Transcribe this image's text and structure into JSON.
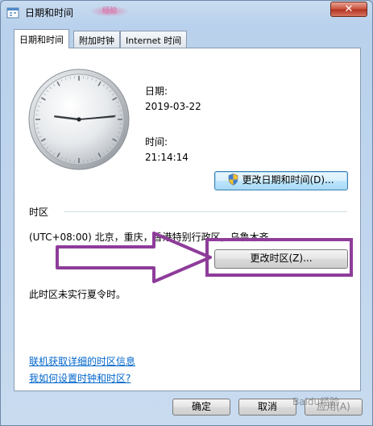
{
  "window": {
    "title": "日期和时间",
    "title_smudge": "经验",
    "close_label": "✕"
  },
  "tabs": [
    {
      "label": "日期和时间",
      "active": true
    },
    {
      "label": "附加时钟",
      "active": false
    },
    {
      "label": "Internet 时间",
      "active": false
    }
  ],
  "clock": {
    "hour": 21,
    "minute": 14,
    "second": 14
  },
  "date": {
    "label": "日期:",
    "value": "2019-03-22"
  },
  "time": {
    "label": "时间:",
    "value": "21:14:14"
  },
  "change_datetime_button": "更改日期和时间(D)...",
  "timezone": {
    "section_label": "时区",
    "value": "(UTC+08:00) 北京，重庆，香港特别行政区，乌鲁木齐",
    "change_button": "更改时区(Z)...",
    "dst_note": "此时区未实行夏令时。"
  },
  "links": {
    "more_info": "联机获取详细的时区信息",
    "how_to": "我如何设置时钟和时区?"
  },
  "footer": {
    "ok": "确定",
    "cancel": "取消",
    "apply": "应用(A)"
  },
  "watermark": "Baidu经验",
  "colors": {
    "annotation": "#8e3c9a",
    "link": "#0066cc",
    "close_button": "#c7503a"
  }
}
